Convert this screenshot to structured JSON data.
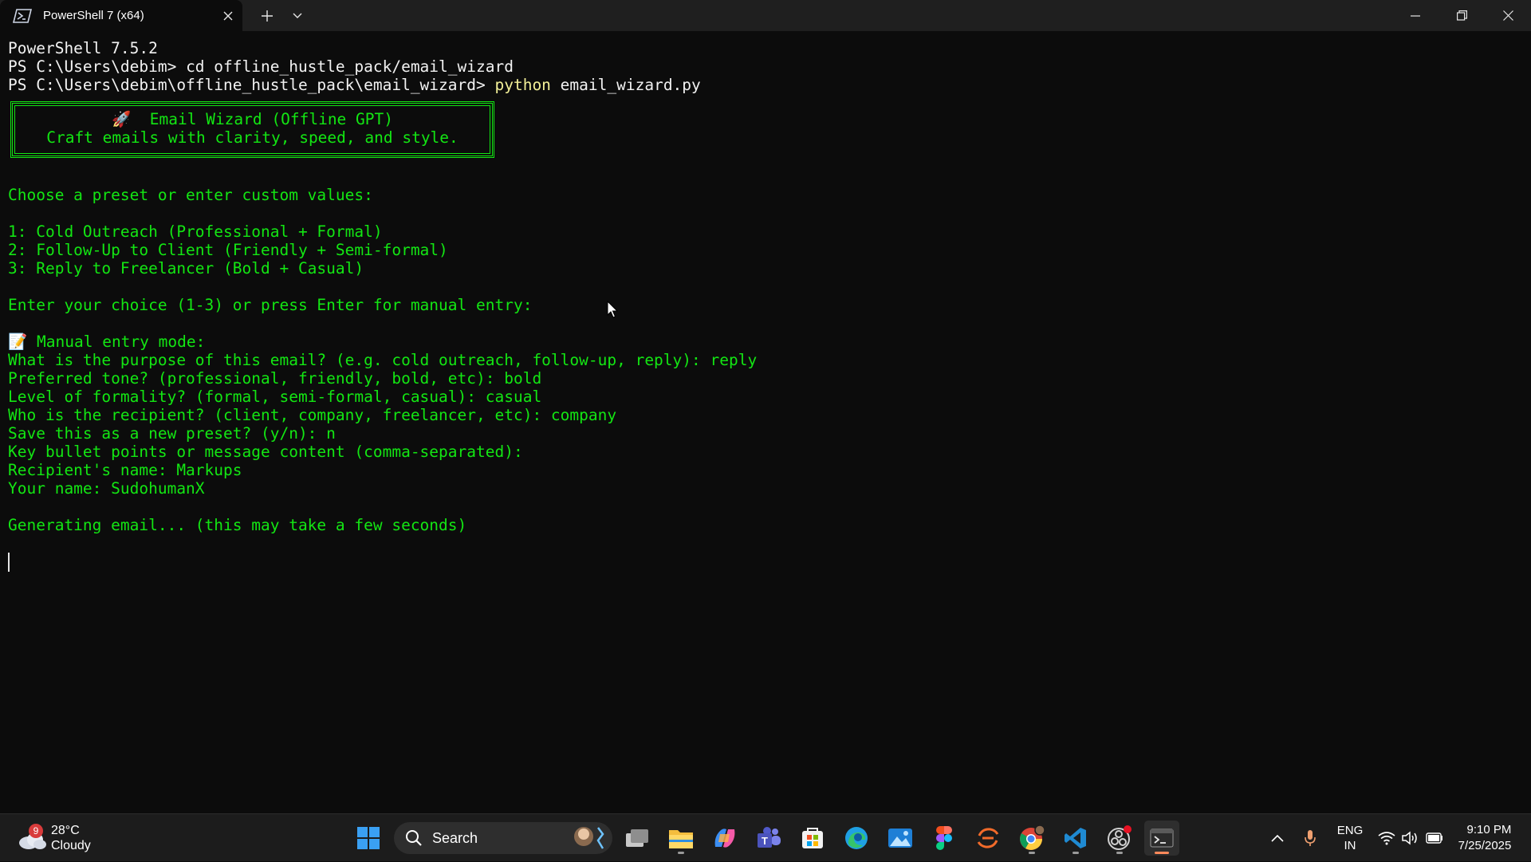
{
  "window": {
    "tab_title": "PowerShell 7 (x64)",
    "icons": {
      "tab": "powershell-icon",
      "close_tab": "close-icon",
      "new_tab": "plus-icon",
      "dropdown": "chevron-down-icon",
      "minimize": "minimize-icon",
      "maximize": "restore-icon",
      "close": "close-icon"
    }
  },
  "terminal": {
    "lines": [
      "PowerShell 7.5.2",
      "PS C:\\Users\\debim> ",
      "cd offline_hustle_pack/email_wizard",
      "PS C:\\Users\\debim\\offline_hustle_pack\\email_wizard> ",
      "python",
      " email_wizard.py"
    ],
    "banner": {
      "title": "🚀  Email Wizard (Offline GPT)",
      "subtitle": "Craft emails with clarity, speed, and style."
    },
    "body": [
      "Choose a preset or enter custom values:",
      "1: Cold Outreach (Professional + Formal)",
      "2: Follow-Up to Client (Friendly + Semi-formal)",
      "3: Reply to Freelancer (Bold + Casual)",
      "Enter your choice (1-3) or press Enter for manual entry:",
      "📝 Manual entry mode:",
      "What is the purpose of this email? (e.g. cold outreach, follow-up, reply): reply",
      "Preferred tone? (professional, friendly, bold, etc): bold",
      "Level of formality? (formal, semi-formal, casual): casual",
      "Who is the recipient? (client, company, freelancer, etc): company",
      "Save this as a new preset? (y/n): n",
      "Key bullet points or message content (comma-separated):",
      "Recipient's name: Markups",
      "Your name: SudohumanX",
      "Generating email... (this may take a few seconds)"
    ],
    "colors": {
      "background": "#0c0c0c",
      "text": "#e6e6e6",
      "script_output": "#13e613",
      "command": "#f3f098"
    }
  },
  "taskbar": {
    "weather": {
      "temp": "28°C",
      "condition": "Cloudy",
      "badge": "9",
      "icon": "cloud-icon"
    },
    "search_label": "Search",
    "apps": [
      "windows-start-icon",
      "task-view-icon",
      "file-explorer-icon",
      "copilot-icon",
      "teams-icon",
      "microsoft-store-icon",
      "edge-icon",
      "photos-icon",
      "figma-icon",
      "app-sync-icon",
      "chrome-icon",
      "vscode-icon",
      "obs-icon",
      "terminal-icon"
    ],
    "tray": {
      "lang_top": "ENG",
      "lang_bottom": "IN",
      "time": "9:10 PM",
      "date": "7/25/2025",
      "icons": [
        "chevron-up-icon",
        "microphone-icon",
        "wifi-icon",
        "volume-icon",
        "battery-icon"
      ]
    }
  }
}
